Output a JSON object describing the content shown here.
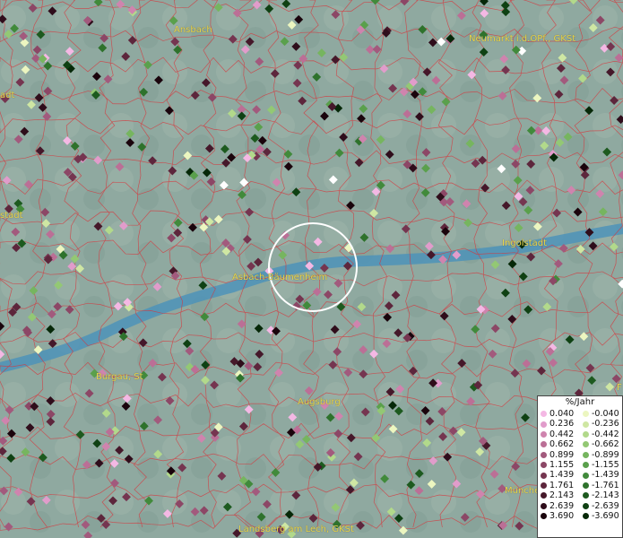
{
  "map": {
    "places": [
      {
        "id": "ansbach",
        "label": "Ansbach"
      },
      {
        "id": "neumarkt",
        "label": "Neumarkt i.d.OPf., GKSt"
      },
      {
        "id": "left-adt",
        "label": "adt"
      },
      {
        "id": "left-stadt",
        "label": "stadt"
      },
      {
        "id": "ingolstadt",
        "label": "Ingolstadt"
      },
      {
        "id": "asbach",
        "label": "Asbach-Bäumenheim"
      },
      {
        "id": "burgau",
        "label": "Burgau, St"
      },
      {
        "id": "augsburg",
        "label": "Augsburg"
      },
      {
        "id": "muenchen",
        "label": "München"
      },
      {
        "id": "landsberg",
        "label": "Landsberg am Lech, GKSt"
      },
      {
        "id": "right-f",
        "label": "F"
      }
    ],
    "colors": {
      "terrain": "#8fa9a0",
      "river": "#4d93b8",
      "boundaries": "#d8343a",
      "labels": "#e8d64a",
      "selection_circle": "#ffffff"
    }
  },
  "legend": {
    "title": "%/Jahr",
    "positive": [
      {
        "label": "0.040",
        "color": "#f4b8e4"
      },
      {
        "label": "0.236",
        "color": "#e19ccb"
      },
      {
        "label": "0.442",
        "color": "#cf84ae"
      },
      {
        "label": "0.662",
        "color": "#bb6f96"
      },
      {
        "label": "0.899",
        "color": "#a25a7d"
      },
      {
        "label": "1.155",
        "color": "#8c4766"
      },
      {
        "label": "1.439",
        "color": "#753550"
      },
      {
        "label": "1.761",
        "color": "#5d263c"
      },
      {
        "label": "2.143",
        "color": "#45182a"
      },
      {
        "label": "2.639",
        "color": "#2f0d1b"
      },
      {
        "label": "3.690",
        "color": "#1a040c"
      }
    ],
    "negative": [
      {
        "label": "-0.040",
        "color": "#ecf6c0"
      },
      {
        "label": "-0.236",
        "color": "#cfe7a3"
      },
      {
        "label": "-0.442",
        "color": "#b2d98b"
      },
      {
        "label": "-0.662",
        "color": "#93c874"
      },
      {
        "label": "-0.899",
        "color": "#76b55f"
      },
      {
        "label": "-1.155",
        "color": "#5aa04c"
      },
      {
        "label": "-1.439",
        "color": "#418a3b"
      },
      {
        "label": "-1.761",
        "color": "#2e722c"
      },
      {
        "label": "-2.143",
        "color": "#1d5a1f"
      },
      {
        "label": "-2.639",
        "color": "#0f4113"
      },
      {
        "label": "-3.690",
        "color": "#062808"
      }
    ]
  }
}
